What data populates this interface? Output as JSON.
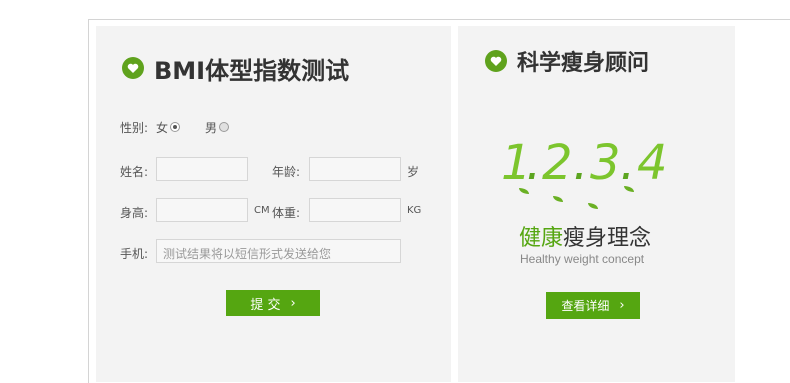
{
  "bmi": {
    "title": "BMI体型指数测试",
    "gender_label": "性别:",
    "gender_female": "女",
    "gender_male": "男",
    "name_label": "姓名:",
    "age_label": "年龄:",
    "age_unit": "岁",
    "height_label": "身高:",
    "height_unit": "CM",
    "weight_label": "体重:",
    "weight_unit": "KG",
    "phone_label": "手机:",
    "phone_placeholder": "测试结果将以短信形式发送给您",
    "submit_label": "提 交",
    "submit_chevron": "›"
  },
  "advisor": {
    "title": "科学瘦身顾问",
    "digits": [
      "1",
      "2",
      "3",
      "4"
    ],
    "dot": ".",
    "slogan_green": "健康",
    "slogan_dark": "瘦身理念",
    "slogan_en": "Healthy weight concept",
    "details_label": "查看详细",
    "details_chevron": "›"
  },
  "colors": {
    "accent": "#55a611",
    "heart": "#5fa21d",
    "digit": "#7cc52d"
  }
}
